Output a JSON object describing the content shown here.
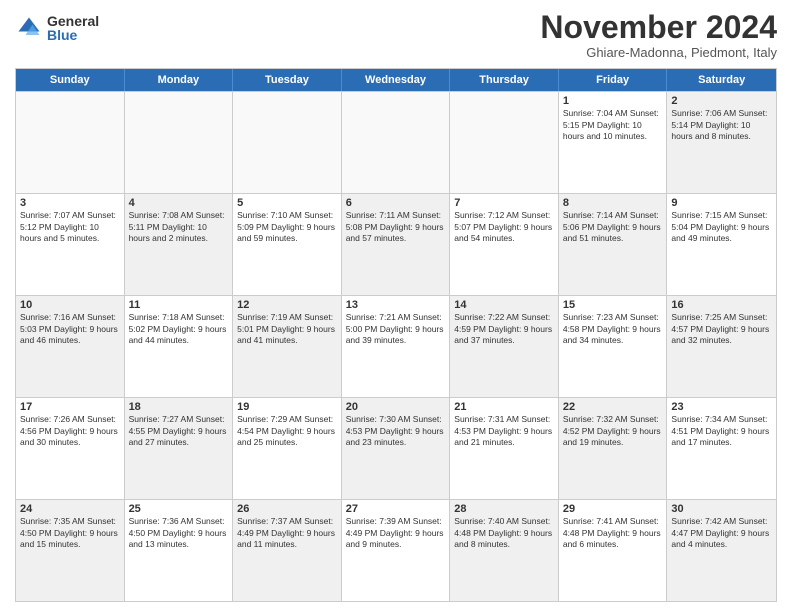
{
  "logo": {
    "general": "General",
    "blue": "Blue"
  },
  "title": "November 2024",
  "location": "Ghiare-Madonna, Piedmont, Italy",
  "headers": [
    "Sunday",
    "Monday",
    "Tuesday",
    "Wednesday",
    "Thursday",
    "Friday",
    "Saturday"
  ],
  "weeks": [
    [
      {
        "day": "",
        "info": "",
        "empty": true
      },
      {
        "day": "",
        "info": "",
        "empty": true
      },
      {
        "day": "",
        "info": "",
        "empty": true
      },
      {
        "day": "",
        "info": "",
        "empty": true
      },
      {
        "day": "",
        "info": "",
        "empty": true
      },
      {
        "day": "1",
        "info": "Sunrise: 7:04 AM\nSunset: 5:15 PM\nDaylight: 10 hours\nand 10 minutes.",
        "empty": false
      },
      {
        "day": "2",
        "info": "Sunrise: 7:06 AM\nSunset: 5:14 PM\nDaylight: 10 hours\nand 8 minutes.",
        "empty": false,
        "shaded": true
      }
    ],
    [
      {
        "day": "3",
        "info": "Sunrise: 7:07 AM\nSunset: 5:12 PM\nDaylight: 10 hours\nand 5 minutes.",
        "empty": false
      },
      {
        "day": "4",
        "info": "Sunrise: 7:08 AM\nSunset: 5:11 PM\nDaylight: 10 hours\nand 2 minutes.",
        "empty": false,
        "shaded": true
      },
      {
        "day": "5",
        "info": "Sunrise: 7:10 AM\nSunset: 5:09 PM\nDaylight: 9 hours\nand 59 minutes.",
        "empty": false
      },
      {
        "day": "6",
        "info": "Sunrise: 7:11 AM\nSunset: 5:08 PM\nDaylight: 9 hours\nand 57 minutes.",
        "empty": false,
        "shaded": true
      },
      {
        "day": "7",
        "info": "Sunrise: 7:12 AM\nSunset: 5:07 PM\nDaylight: 9 hours\nand 54 minutes.",
        "empty": false
      },
      {
        "day": "8",
        "info": "Sunrise: 7:14 AM\nSunset: 5:06 PM\nDaylight: 9 hours\nand 51 minutes.",
        "empty": false,
        "shaded": true
      },
      {
        "day": "9",
        "info": "Sunrise: 7:15 AM\nSunset: 5:04 PM\nDaylight: 9 hours\nand 49 minutes.",
        "empty": false
      }
    ],
    [
      {
        "day": "10",
        "info": "Sunrise: 7:16 AM\nSunset: 5:03 PM\nDaylight: 9 hours\nand 46 minutes.",
        "empty": false,
        "shaded": true
      },
      {
        "day": "11",
        "info": "Sunrise: 7:18 AM\nSunset: 5:02 PM\nDaylight: 9 hours\nand 44 minutes.",
        "empty": false
      },
      {
        "day": "12",
        "info": "Sunrise: 7:19 AM\nSunset: 5:01 PM\nDaylight: 9 hours\nand 41 minutes.",
        "empty": false,
        "shaded": true
      },
      {
        "day": "13",
        "info": "Sunrise: 7:21 AM\nSunset: 5:00 PM\nDaylight: 9 hours\nand 39 minutes.",
        "empty": false
      },
      {
        "day": "14",
        "info": "Sunrise: 7:22 AM\nSunset: 4:59 PM\nDaylight: 9 hours\nand 37 minutes.",
        "empty": false,
        "shaded": true
      },
      {
        "day": "15",
        "info": "Sunrise: 7:23 AM\nSunset: 4:58 PM\nDaylight: 9 hours\nand 34 minutes.",
        "empty": false
      },
      {
        "day": "16",
        "info": "Sunrise: 7:25 AM\nSunset: 4:57 PM\nDaylight: 9 hours\nand 32 minutes.",
        "empty": false,
        "shaded": true
      }
    ],
    [
      {
        "day": "17",
        "info": "Sunrise: 7:26 AM\nSunset: 4:56 PM\nDaylight: 9 hours\nand 30 minutes.",
        "empty": false
      },
      {
        "day": "18",
        "info": "Sunrise: 7:27 AM\nSunset: 4:55 PM\nDaylight: 9 hours\nand 27 minutes.",
        "empty": false,
        "shaded": true
      },
      {
        "day": "19",
        "info": "Sunrise: 7:29 AM\nSunset: 4:54 PM\nDaylight: 9 hours\nand 25 minutes.",
        "empty": false
      },
      {
        "day": "20",
        "info": "Sunrise: 7:30 AM\nSunset: 4:53 PM\nDaylight: 9 hours\nand 23 minutes.",
        "empty": false,
        "shaded": true
      },
      {
        "day": "21",
        "info": "Sunrise: 7:31 AM\nSunset: 4:53 PM\nDaylight: 9 hours\nand 21 minutes.",
        "empty": false
      },
      {
        "day": "22",
        "info": "Sunrise: 7:32 AM\nSunset: 4:52 PM\nDaylight: 9 hours\nand 19 minutes.",
        "empty": false,
        "shaded": true
      },
      {
        "day": "23",
        "info": "Sunrise: 7:34 AM\nSunset: 4:51 PM\nDaylight: 9 hours\nand 17 minutes.",
        "empty": false
      }
    ],
    [
      {
        "day": "24",
        "info": "Sunrise: 7:35 AM\nSunset: 4:50 PM\nDaylight: 9 hours\nand 15 minutes.",
        "empty": false,
        "shaded": true
      },
      {
        "day": "25",
        "info": "Sunrise: 7:36 AM\nSunset: 4:50 PM\nDaylight: 9 hours\nand 13 minutes.",
        "empty": false
      },
      {
        "day": "26",
        "info": "Sunrise: 7:37 AM\nSunset: 4:49 PM\nDaylight: 9 hours\nand 11 minutes.",
        "empty": false,
        "shaded": true
      },
      {
        "day": "27",
        "info": "Sunrise: 7:39 AM\nSunset: 4:49 PM\nDaylight: 9 hours\nand 9 minutes.",
        "empty": false
      },
      {
        "day": "28",
        "info": "Sunrise: 7:40 AM\nSunset: 4:48 PM\nDaylight: 9 hours\nand 8 minutes.",
        "empty": false,
        "shaded": true
      },
      {
        "day": "29",
        "info": "Sunrise: 7:41 AM\nSunset: 4:48 PM\nDaylight: 9 hours\nand 6 minutes.",
        "empty": false
      },
      {
        "day": "30",
        "info": "Sunrise: 7:42 AM\nSunset: 4:47 PM\nDaylight: 9 hours\nand 4 minutes.",
        "empty": false,
        "shaded": true
      }
    ]
  ]
}
